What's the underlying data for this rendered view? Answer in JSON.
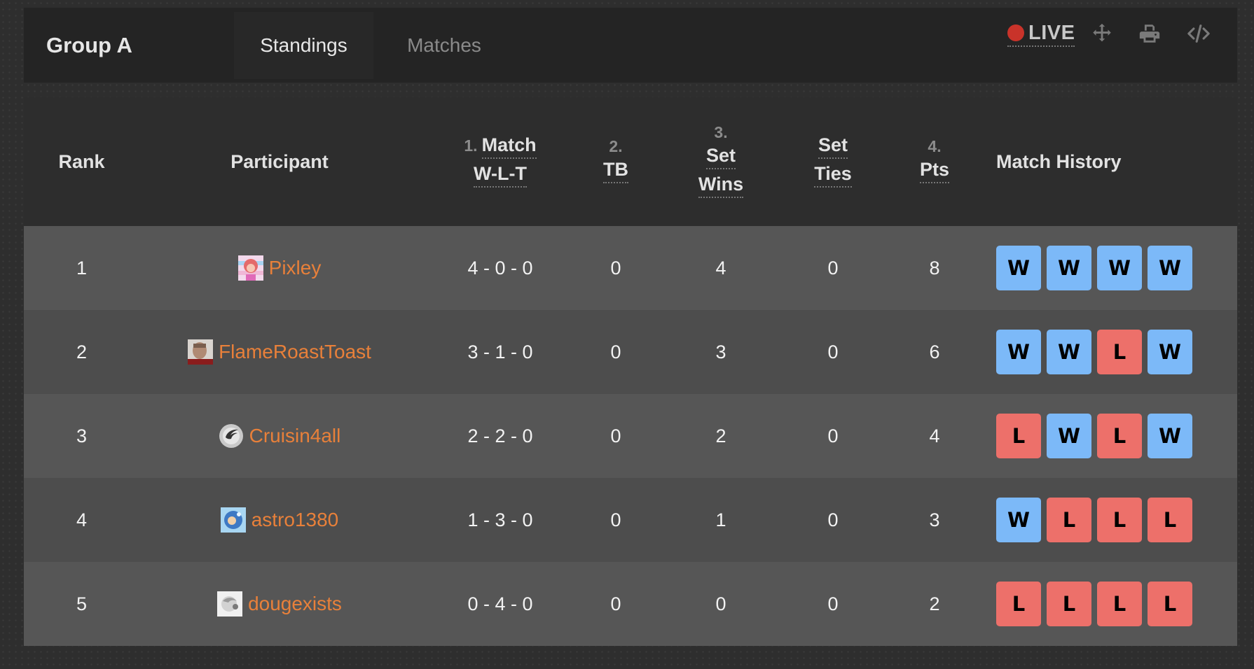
{
  "header": {
    "title": "Group A",
    "tabs": [
      {
        "label": "Standings",
        "active": true
      },
      {
        "label": "Matches",
        "active": false
      }
    ],
    "live_label": "LIVE",
    "tools": [
      "move-icon",
      "print-icon",
      "embed-code-icon"
    ]
  },
  "table": {
    "columns": {
      "rank": "Rank",
      "participant": "Participant",
      "match_wlt": {
        "num": "1.",
        "line1": "Match",
        "line2": "W-L-T"
      },
      "tb": {
        "num": "2.",
        "line1": "TB"
      },
      "set_wins": {
        "num": "3.",
        "line1": "Set",
        "line2": "Wins"
      },
      "set_ties": {
        "line1": "Set",
        "line2": "Ties"
      },
      "pts": {
        "num": "4.",
        "line1": "Pts"
      },
      "history": "Match History"
    },
    "rows": [
      {
        "rank": "1",
        "name": "Pixley",
        "avatar": "pixley-avatar",
        "wlt": "4 - 0 - 0",
        "tb": "0",
        "set_wins": "4",
        "set_ties": "0",
        "pts": "8",
        "history": [
          "W",
          "W",
          "W",
          "W"
        ]
      },
      {
        "rank": "2",
        "name": "FlameRoastToast",
        "avatar": "flameroasttoast-avatar",
        "wlt": "3 - 1 - 0",
        "tb": "0",
        "set_wins": "3",
        "set_ties": "0",
        "pts": "6",
        "history": [
          "W",
          "W",
          "L",
          "W"
        ]
      },
      {
        "rank": "3",
        "name": "Cruisin4all",
        "avatar": "cruisin4all-avatar",
        "wlt": "2 - 2 - 0",
        "tb": "0",
        "set_wins": "2",
        "set_ties": "0",
        "pts": "4",
        "history": [
          "L",
          "W",
          "L",
          "W"
        ]
      },
      {
        "rank": "4",
        "name": "astro1380",
        "avatar": "astro1380-avatar",
        "wlt": "1 - 3 - 0",
        "tb": "0",
        "set_wins": "1",
        "set_ties": "0",
        "pts": "3",
        "history": [
          "W",
          "L",
          "L",
          "L"
        ]
      },
      {
        "rank": "5",
        "name": "dougexists",
        "avatar": "dougexists-avatar",
        "wlt": "0 - 4 - 0",
        "tb": "0",
        "set_wins": "0",
        "set_ties": "0",
        "pts": "2",
        "history": [
          "L",
          "L",
          "L",
          "L"
        ]
      }
    ]
  },
  "colors": {
    "win": "#7cb9f8",
    "loss": "#ed706a",
    "participant_link": "#e8803a",
    "live_dot": "#c9332a"
  }
}
